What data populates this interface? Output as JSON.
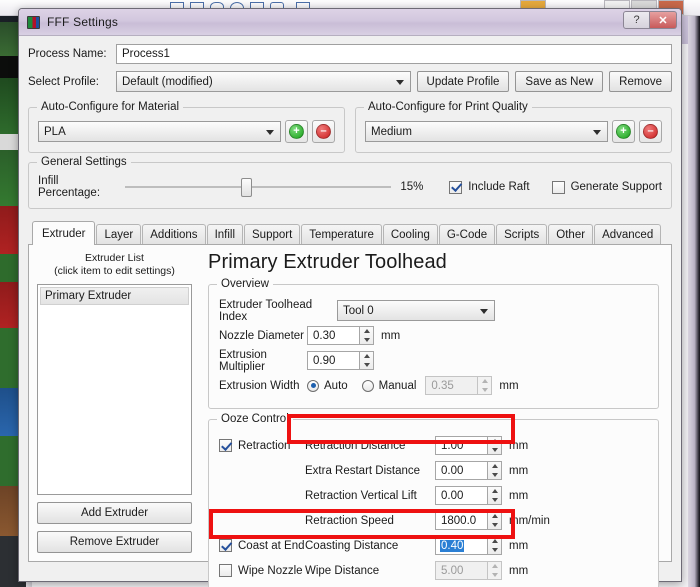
{
  "window": {
    "title": "FFF Settings",
    "help_label": "?",
    "close_label": "✕"
  },
  "top_form": {
    "process_name_label": "Process Name:",
    "process_name_value": "Process1",
    "select_profile_label": "Select Profile:",
    "select_profile_value": "Default (modified)",
    "update_profile_label": "Update Profile",
    "save_as_new_label": "Save as New",
    "remove_label": "Remove"
  },
  "auto_material": {
    "title": "Auto-Configure for Material",
    "value": "PLA",
    "add_label": "+",
    "remove_label": "–"
  },
  "auto_quality": {
    "title": "Auto-Configure for Print Quality",
    "value": "Medium",
    "add_label": "+",
    "remove_label": "–"
  },
  "general": {
    "title": "General Settings",
    "infill_label": "Infill Percentage:",
    "infill_value": "15%",
    "include_raft_label": "Include Raft",
    "include_raft_checked": true,
    "generate_support_label": "Generate Support",
    "generate_support_checked": false
  },
  "tabs": [
    {
      "label": "Extruder",
      "active": true
    },
    {
      "label": "Layer",
      "active": false
    },
    {
      "label": "Additions",
      "active": false
    },
    {
      "label": "Infill",
      "active": false
    },
    {
      "label": "Support",
      "active": false
    },
    {
      "label": "Temperature",
      "active": false
    },
    {
      "label": "Cooling",
      "active": false
    },
    {
      "label": "G-Code",
      "active": false
    },
    {
      "label": "Scripts",
      "active": false
    },
    {
      "label": "Other",
      "active": false
    },
    {
      "label": "Advanced",
      "active": false
    }
  ],
  "extruder_list": {
    "title_line1": "Extruder List",
    "title_line2": "(click item to edit settings)",
    "items": [
      "Primary Extruder"
    ],
    "add_button": "Add Extruder",
    "remove_button": "Remove Extruder"
  },
  "page": {
    "heading": "Primary Extruder Toolhead"
  },
  "overview": {
    "title": "Overview",
    "toolhead_index_label": "Extruder Toolhead Index",
    "toolhead_index_value": "Tool 0",
    "nozzle_diameter_label": "Nozzle Diameter",
    "nozzle_diameter_value": "0.30",
    "nozzle_diameter_unit": "mm",
    "extrusion_multiplier_label": "Extrusion Multiplier",
    "extrusion_multiplier_value": "0.90",
    "extrusion_width_label": "Extrusion Width",
    "extrusion_width_auto_label": "Auto",
    "extrusion_width_manual_label": "Manual",
    "extrusion_width_mode": "Auto",
    "extrusion_width_value": "0.35",
    "extrusion_width_unit": "mm"
  },
  "ooze": {
    "title": "Ooze Control",
    "rows": [
      {
        "check_label": "Retraction",
        "checked": true,
        "field_label": "Retraction Distance",
        "value": "1.00",
        "unit": "mm",
        "disabled": false,
        "selected": false,
        "highlighted": true
      },
      {
        "check_label": "",
        "checked": null,
        "field_label": "Extra Restart Distance",
        "value": "0.00",
        "unit": "mm",
        "disabled": false,
        "selected": false,
        "highlighted": false
      },
      {
        "check_label": "",
        "checked": null,
        "field_label": "Retraction Vertical Lift",
        "value": "0.00",
        "unit": "mm",
        "disabled": false,
        "selected": false,
        "highlighted": false
      },
      {
        "check_label": "",
        "checked": null,
        "field_label": "Retraction Speed",
        "value": "1800.0",
        "unit": "mm/min",
        "disabled": false,
        "selected": false,
        "highlighted": false
      },
      {
        "check_label": "Coast at End",
        "checked": true,
        "field_label": "Coasting Distance",
        "value": "0.40",
        "unit": "mm",
        "disabled": false,
        "selected": true,
        "highlighted": true
      },
      {
        "check_label": "Wipe Nozzle",
        "checked": false,
        "field_label": "Wipe Distance",
        "value": "5.00",
        "unit": "mm",
        "disabled": true,
        "selected": false,
        "highlighted": false
      }
    ]
  },
  "colors": {
    "annotation": "#ee1111",
    "selection": "#2a7fd4",
    "titlebar": "#d2c7de"
  }
}
